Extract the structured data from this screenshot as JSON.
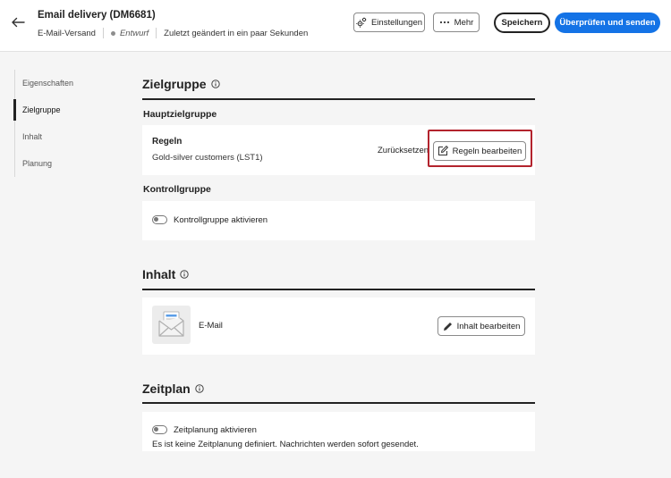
{
  "header": {
    "title": "Email delivery (DM6681)",
    "channel": "E-Mail-Versand",
    "status": "Entwurf",
    "last_modified": "Zuletzt geändert in ein paar Sekunden",
    "settings_label": "Einstellungen",
    "more_label": "Mehr",
    "save_label": "Speichern",
    "review_label": "Überprüfen und senden"
  },
  "nav": {
    "items": [
      {
        "label": "Eigenschaften"
      },
      {
        "label": "Zielgruppe"
      },
      {
        "label": "Inhalt"
      },
      {
        "label": "Planung"
      }
    ],
    "active": "Zielgruppe"
  },
  "audience": {
    "title": "Zielgruppe",
    "main_title": "Hauptzielgruppe",
    "rules_label": "Regeln",
    "rules_value": "Gold-silver customers (LST1)",
    "reset_label": "Zurücksetzen",
    "edit_rules_label": "Regeln bearbeiten",
    "control_title": "Kontrollgruppe",
    "control_toggle_label": "Kontrollgruppe aktivieren",
    "control_enabled": false
  },
  "content": {
    "title": "Inhalt",
    "type_label": "E-Mail",
    "edit_label": "Inhalt bearbeiten"
  },
  "schedule": {
    "title": "Zeitplan",
    "toggle_label": "Zeitplanung aktivieren",
    "toggle_enabled": false,
    "note": "Es ist keine Zeitplanung definiert. Nachrichten werden sofort gesendet."
  },
  "colors": {
    "accent": "#1473e6",
    "highlight": "#b3232d"
  }
}
